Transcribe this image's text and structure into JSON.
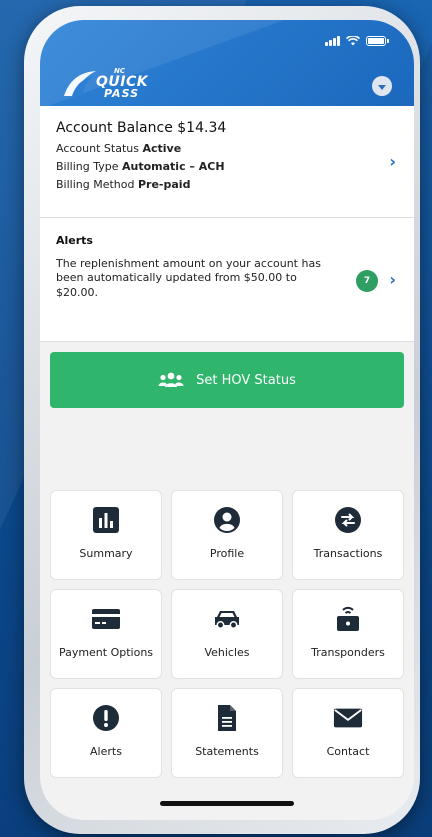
{
  "header": {
    "logo_nc": "NC",
    "logo_quick": "QUICK",
    "logo_pass": "PASS"
  },
  "account": {
    "title_label": "Account Balance",
    "balance": "$14.34",
    "status_label": "Account Status",
    "status_value": "Active",
    "billing_type_label": "Billing Type",
    "billing_type_value": "Automatic – ACH",
    "billing_method_label": "Billing Method",
    "billing_method_value": "Pre-paid"
  },
  "alerts": {
    "title": "Alerts",
    "message": "The replenishment amount on your account has been automatically updated from $50.00 to $20.00.",
    "count": "7"
  },
  "hov": {
    "label": "Set HOV Status"
  },
  "menu": [
    {
      "label": "Summary",
      "icon": "bar-chart-icon"
    },
    {
      "label": "Profile",
      "icon": "user-icon"
    },
    {
      "label": "Transactions",
      "icon": "transfer-icon"
    },
    {
      "label": "Payment Options",
      "icon": "credit-card-icon"
    },
    {
      "label": "Vehicles",
      "icon": "car-icon"
    },
    {
      "label": "Transponders",
      "icon": "transponder-icon"
    },
    {
      "label": "Alerts",
      "icon": "exclamation-icon"
    },
    {
      "label": "Statements",
      "icon": "document-icon"
    },
    {
      "label": "Contact",
      "icon": "envelope-icon"
    }
  ],
  "colors": {
    "brand_blue": "#1f6fbe",
    "hov_green": "#2fb56c",
    "badge_green": "#2e9e63",
    "icon_dark": "#1e2b38"
  }
}
